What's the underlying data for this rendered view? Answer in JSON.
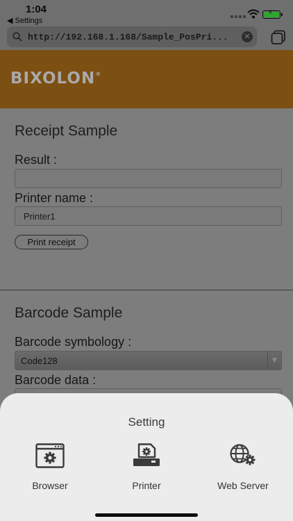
{
  "status_bar": {
    "time": "1:04",
    "back_app": "◀ Settings"
  },
  "url_bar": {
    "url": "http://192.168.1.168/Sample_PosPri..."
  },
  "banner": {
    "logo_text": "BIXOLON",
    "logo_mark": "®"
  },
  "receipt": {
    "title": "Receipt Sample",
    "result_label": "Result :",
    "result_value": "",
    "printer_label": "Printer name :",
    "printer_value": "Printer1",
    "print_button": "Print receipt"
  },
  "barcode": {
    "title": "Barcode Sample",
    "symbology_label": "Barcode symbology :",
    "symbology_value": "Code128",
    "data_label": "Barcode data :"
  },
  "sheet": {
    "title": "Setting",
    "actions": [
      {
        "label": "Browser",
        "icon": "browser-settings-icon"
      },
      {
        "label": "Printer",
        "icon": "printer-settings-icon"
      },
      {
        "label": "Web Server",
        "icon": "web-server-settings-icon"
      }
    ]
  },
  "colors": {
    "banner": "#7c4f12",
    "sheet_bg": "#ececec",
    "overlay": "#7d7d7d"
  }
}
